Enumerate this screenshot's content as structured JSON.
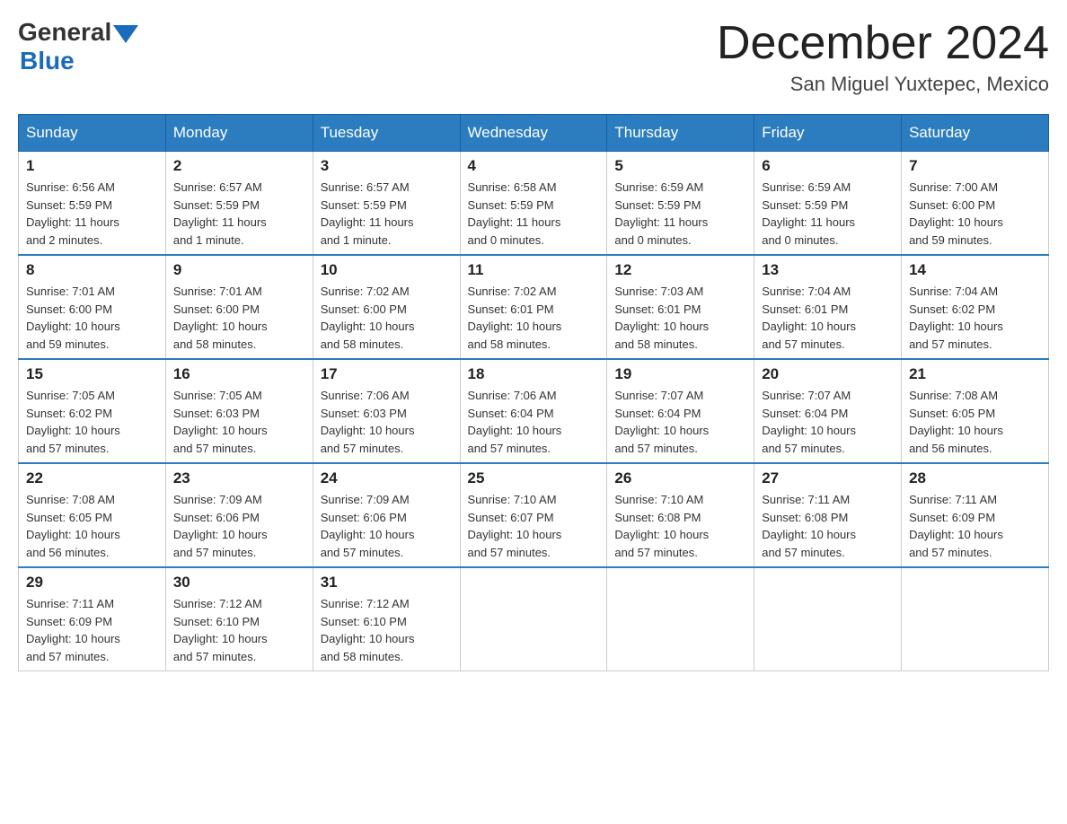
{
  "logo": {
    "general": "General",
    "blue": "Blue"
  },
  "title": {
    "month": "December 2024",
    "location": "San Miguel Yuxtepec, Mexico"
  },
  "headers": [
    "Sunday",
    "Monday",
    "Tuesday",
    "Wednesday",
    "Thursday",
    "Friday",
    "Saturday"
  ],
  "weeks": [
    [
      {
        "day": "1",
        "info": "Sunrise: 6:56 AM\nSunset: 5:59 PM\nDaylight: 11 hours\nand 2 minutes."
      },
      {
        "day": "2",
        "info": "Sunrise: 6:57 AM\nSunset: 5:59 PM\nDaylight: 11 hours\nand 1 minute."
      },
      {
        "day": "3",
        "info": "Sunrise: 6:57 AM\nSunset: 5:59 PM\nDaylight: 11 hours\nand 1 minute."
      },
      {
        "day": "4",
        "info": "Sunrise: 6:58 AM\nSunset: 5:59 PM\nDaylight: 11 hours\nand 0 minutes."
      },
      {
        "day": "5",
        "info": "Sunrise: 6:59 AM\nSunset: 5:59 PM\nDaylight: 11 hours\nand 0 minutes."
      },
      {
        "day": "6",
        "info": "Sunrise: 6:59 AM\nSunset: 5:59 PM\nDaylight: 11 hours\nand 0 minutes."
      },
      {
        "day": "7",
        "info": "Sunrise: 7:00 AM\nSunset: 6:00 PM\nDaylight: 10 hours\nand 59 minutes."
      }
    ],
    [
      {
        "day": "8",
        "info": "Sunrise: 7:01 AM\nSunset: 6:00 PM\nDaylight: 10 hours\nand 59 minutes."
      },
      {
        "day": "9",
        "info": "Sunrise: 7:01 AM\nSunset: 6:00 PM\nDaylight: 10 hours\nand 58 minutes."
      },
      {
        "day": "10",
        "info": "Sunrise: 7:02 AM\nSunset: 6:00 PM\nDaylight: 10 hours\nand 58 minutes."
      },
      {
        "day": "11",
        "info": "Sunrise: 7:02 AM\nSunset: 6:01 PM\nDaylight: 10 hours\nand 58 minutes."
      },
      {
        "day": "12",
        "info": "Sunrise: 7:03 AM\nSunset: 6:01 PM\nDaylight: 10 hours\nand 58 minutes."
      },
      {
        "day": "13",
        "info": "Sunrise: 7:04 AM\nSunset: 6:01 PM\nDaylight: 10 hours\nand 57 minutes."
      },
      {
        "day": "14",
        "info": "Sunrise: 7:04 AM\nSunset: 6:02 PM\nDaylight: 10 hours\nand 57 minutes."
      }
    ],
    [
      {
        "day": "15",
        "info": "Sunrise: 7:05 AM\nSunset: 6:02 PM\nDaylight: 10 hours\nand 57 minutes."
      },
      {
        "day": "16",
        "info": "Sunrise: 7:05 AM\nSunset: 6:03 PM\nDaylight: 10 hours\nand 57 minutes."
      },
      {
        "day": "17",
        "info": "Sunrise: 7:06 AM\nSunset: 6:03 PM\nDaylight: 10 hours\nand 57 minutes."
      },
      {
        "day": "18",
        "info": "Sunrise: 7:06 AM\nSunset: 6:04 PM\nDaylight: 10 hours\nand 57 minutes."
      },
      {
        "day": "19",
        "info": "Sunrise: 7:07 AM\nSunset: 6:04 PM\nDaylight: 10 hours\nand 57 minutes."
      },
      {
        "day": "20",
        "info": "Sunrise: 7:07 AM\nSunset: 6:04 PM\nDaylight: 10 hours\nand 57 minutes."
      },
      {
        "day": "21",
        "info": "Sunrise: 7:08 AM\nSunset: 6:05 PM\nDaylight: 10 hours\nand 56 minutes."
      }
    ],
    [
      {
        "day": "22",
        "info": "Sunrise: 7:08 AM\nSunset: 6:05 PM\nDaylight: 10 hours\nand 56 minutes."
      },
      {
        "day": "23",
        "info": "Sunrise: 7:09 AM\nSunset: 6:06 PM\nDaylight: 10 hours\nand 57 minutes."
      },
      {
        "day": "24",
        "info": "Sunrise: 7:09 AM\nSunset: 6:06 PM\nDaylight: 10 hours\nand 57 minutes."
      },
      {
        "day": "25",
        "info": "Sunrise: 7:10 AM\nSunset: 6:07 PM\nDaylight: 10 hours\nand 57 minutes."
      },
      {
        "day": "26",
        "info": "Sunrise: 7:10 AM\nSunset: 6:08 PM\nDaylight: 10 hours\nand 57 minutes."
      },
      {
        "day": "27",
        "info": "Sunrise: 7:11 AM\nSunset: 6:08 PM\nDaylight: 10 hours\nand 57 minutes."
      },
      {
        "day": "28",
        "info": "Sunrise: 7:11 AM\nSunset: 6:09 PM\nDaylight: 10 hours\nand 57 minutes."
      }
    ],
    [
      {
        "day": "29",
        "info": "Sunrise: 7:11 AM\nSunset: 6:09 PM\nDaylight: 10 hours\nand 57 minutes."
      },
      {
        "day": "30",
        "info": "Sunrise: 7:12 AM\nSunset: 6:10 PM\nDaylight: 10 hours\nand 57 minutes."
      },
      {
        "day": "31",
        "info": "Sunrise: 7:12 AM\nSunset: 6:10 PM\nDaylight: 10 hours\nand 58 minutes."
      },
      {
        "day": "",
        "info": ""
      },
      {
        "day": "",
        "info": ""
      },
      {
        "day": "",
        "info": ""
      },
      {
        "day": "",
        "info": ""
      }
    ]
  ]
}
